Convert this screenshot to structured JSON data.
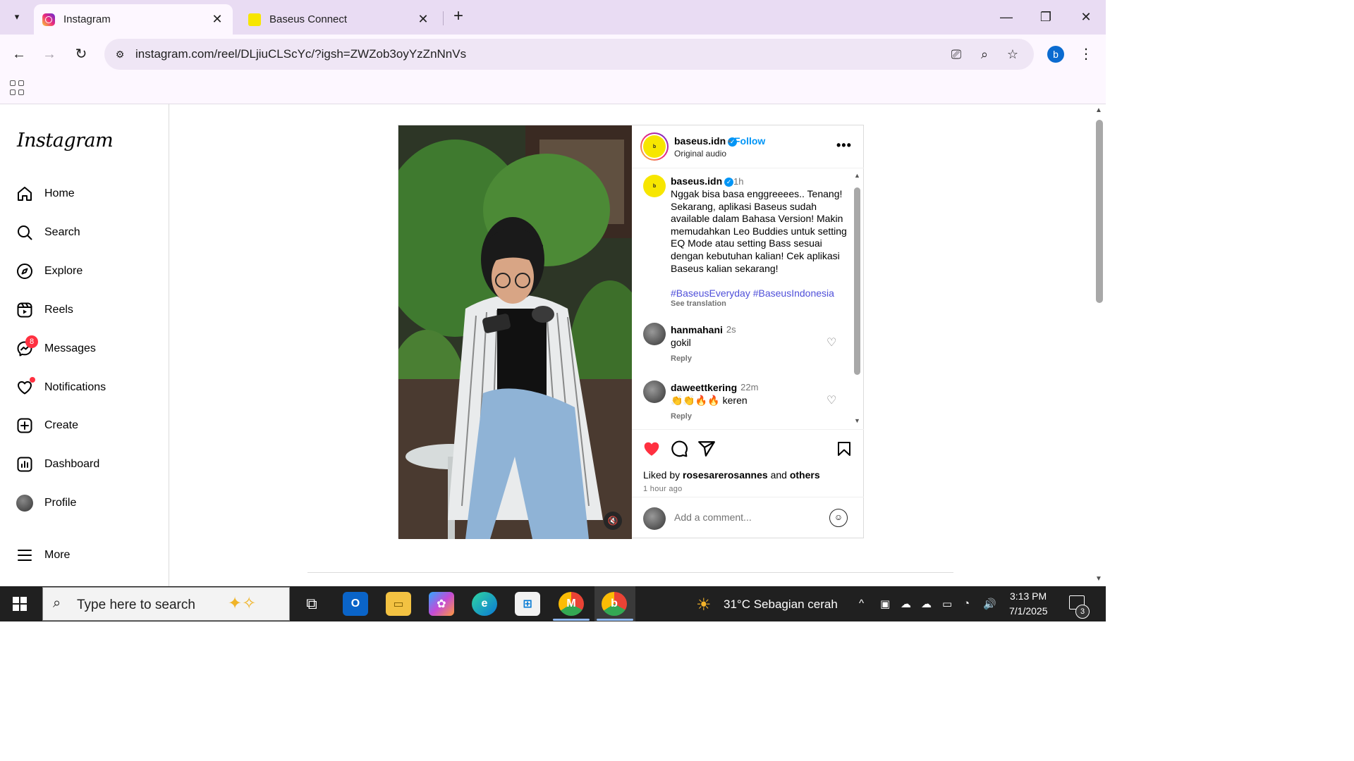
{
  "browser": {
    "tabs": [
      {
        "title": "Instagram",
        "active": true,
        "icon": "instagram-icon"
      },
      {
        "title": "Baseus Connect",
        "active": false,
        "icon": "baseus-icon"
      }
    ],
    "url": "instagram.com/reel/DLjiuCLScYc/?igsh=ZWZob3oyYzZnNnVs",
    "profile_initial": "b"
  },
  "sidebar": {
    "logo": "Instagram",
    "items": [
      {
        "label": "Home",
        "icon": "home-icon"
      },
      {
        "label": "Search",
        "icon": "search-icon"
      },
      {
        "label": "Explore",
        "icon": "compass-icon"
      },
      {
        "label": "Reels",
        "icon": "reels-icon"
      },
      {
        "label": "Messages",
        "icon": "messenger-icon",
        "badge": "8"
      },
      {
        "label": "Notifications",
        "icon": "heart-icon"
      },
      {
        "label": "Create",
        "icon": "plus-square-icon"
      },
      {
        "label": "Dashboard",
        "icon": "dashboard-icon"
      },
      {
        "label": "Profile",
        "icon": "avatar"
      },
      {
        "label": "More",
        "icon": "hamburger-icon"
      }
    ]
  },
  "post": {
    "header": {
      "username": "baseus.idn",
      "follow": "Follow",
      "audio": "Original audio",
      "separator": "•"
    },
    "caption": {
      "username": "baseus.idn",
      "time": "1h",
      "text": "Nggak bisa basa enggreeees.. Tenang! Sekarang, aplikasi Baseus sudah available dalam Bahasa Version! Makin memudahkan Leo Buddies untuk setting EQ Mode atau setting Bass sesuai dengan kebutuhan kalian! Cek aplikasi Baseus kalian sekarang!",
      "hashtags": "#BaseusEveryday #BaseusIndonesia",
      "see_translation": "See translation"
    },
    "comments": [
      {
        "username": "hanmahani",
        "time": "2s",
        "text": "gokil",
        "reply": "Reply"
      },
      {
        "username": "daweettkering",
        "time": "22m",
        "text": "👏👏🔥🔥 keren",
        "reply": "Reply"
      }
    ],
    "likes": {
      "prefix": "Liked by",
      "user": "rosesarerosannes",
      "conj": "and",
      "others": "others"
    },
    "posted": "1 hour ago",
    "add_comment_placeholder": "Add a comment...",
    "brand_mark": "b"
  },
  "taskbar": {
    "search_placeholder": "Type here to search",
    "weather": "31°C  Sebagian cerah",
    "time": "3:13 PM",
    "date": "7/1/2025",
    "notification_count": "3"
  }
}
